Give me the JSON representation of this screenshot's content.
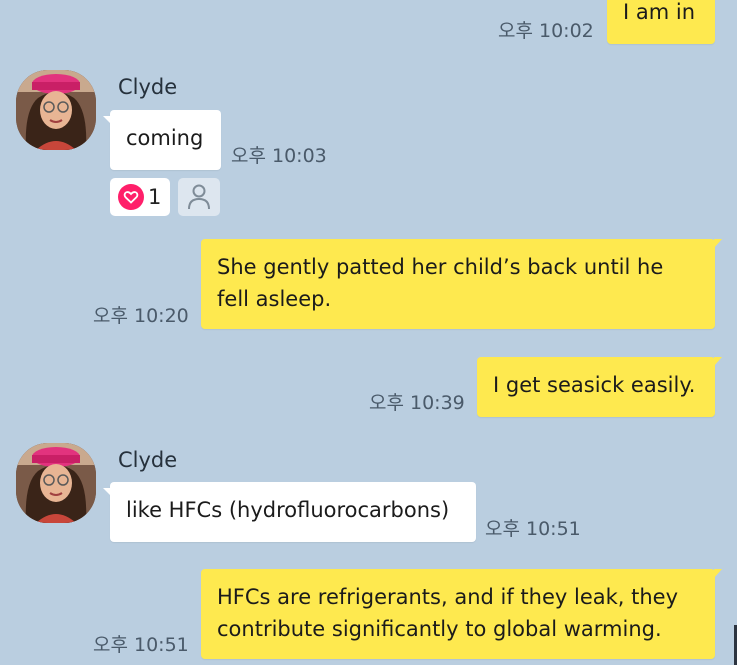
{
  "messages": [
    {
      "direction": "out",
      "text": "I am in",
      "time": "오후 10:02"
    },
    {
      "direction": "in",
      "sender": "Clyde",
      "text": "coming",
      "time": "오후 10:03",
      "reaction": {
        "icon": "heart-icon",
        "count": "1",
        "color": "#ff1f6a"
      }
    },
    {
      "direction": "out",
      "text": "She gently patted her child’s back until he fell asleep.",
      "time": "오후 10:20"
    },
    {
      "direction": "out",
      "text": "I get seasick easily.",
      "time": "오후 10:39"
    },
    {
      "direction": "in",
      "sender": "Clyde",
      "text": "like HFCs (hydrofluorocarbons)",
      "time": "오후 10:51"
    },
    {
      "direction": "out",
      "text": "HFCs are refrigerants, and if they leak, they contribute significantly to global warming.",
      "time": "오후 10:51"
    }
  ],
  "theme": {
    "background": "#bacee0",
    "outgoing_bubble": "#fee94f",
    "incoming_bubble": "#ffffff",
    "time_color": "#4a5a6a"
  }
}
